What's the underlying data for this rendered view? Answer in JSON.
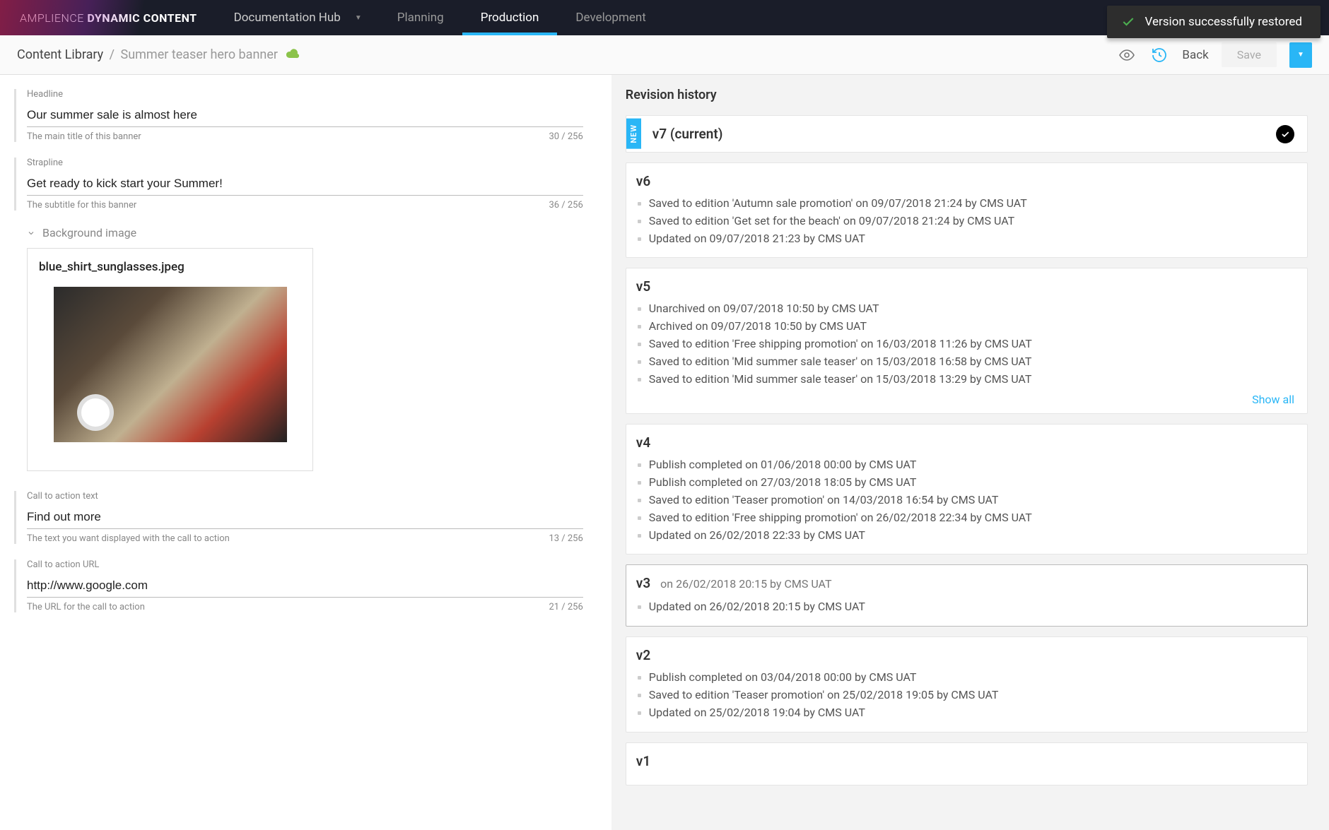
{
  "brand": {
    "light": "AMPLIENCE",
    "bold": "DYNAMIC CONTENT"
  },
  "topnav": {
    "hub": "Documentation Hub",
    "tabs": [
      {
        "label": "Planning",
        "active": false
      },
      {
        "label": "Production",
        "active": true
      },
      {
        "label": "Development",
        "active": false
      }
    ]
  },
  "toast": {
    "message": "Version successfully restored"
  },
  "breadcrumb": {
    "root": "Content Library",
    "leaf": "Summer teaser hero banner"
  },
  "subbar": {
    "back": "Back",
    "save": "Save"
  },
  "form": {
    "headline": {
      "label": "Headline",
      "value": "Our summer sale is almost here",
      "hint": "The main title of this banner",
      "counter": "30 / 256"
    },
    "strapline": {
      "label": "Strapline",
      "value": "Get ready to kick start your Summer!",
      "hint": "The subtitle for this banner",
      "counter": "36 / 256"
    },
    "background": {
      "section_label": "Background image",
      "filename": "blue_shirt_sunglasses.jpeg"
    },
    "cta_text": {
      "label": "Call to action text",
      "value": "Find out more",
      "hint": "The text you want displayed with the call to action",
      "counter": "13 / 256"
    },
    "cta_url": {
      "label": "Call to action URL",
      "value": "http://www.google.com",
      "hint": "The URL for the call to action",
      "counter": "21 / 256"
    }
  },
  "revisions": {
    "title": "Revision history",
    "show_all": "Show all",
    "current": {
      "badge": "NEW",
      "label": "v7 (current)"
    },
    "list": [
      {
        "v": "v6",
        "events": [
          "Saved to edition 'Autumn sale promotion' on 09/07/2018 21:24 by CMS UAT",
          "Saved to edition 'Get set for the beach' on 09/07/2018 21:24 by CMS UAT",
          "Updated on 09/07/2018 21:23 by CMS UAT"
        ]
      },
      {
        "v": "v5",
        "show_all": true,
        "events": [
          "Unarchived on 09/07/2018 10:50 by CMS UAT",
          "Archived on 09/07/2018 10:50 by CMS UAT",
          "Saved to edition 'Free shipping promotion' on 16/03/2018 11:26 by CMS UAT",
          "Saved to edition 'Mid summer sale teaser' on 15/03/2018 16:58 by CMS UAT",
          "Saved to edition 'Mid summer sale teaser' on 15/03/2018 13:29 by CMS UAT"
        ]
      },
      {
        "v": "v4",
        "events": [
          "Publish completed on 01/06/2018 00:00 by CMS UAT",
          "Publish completed on 27/03/2018 18:05 by CMS UAT",
          "Saved to edition 'Teaser promotion' on 14/03/2018 16:54 by CMS UAT",
          "Saved to edition 'Free shipping promotion' on 26/02/2018 22:34 by CMS UAT",
          "Updated on 26/02/2018 22:33 by CMS UAT"
        ]
      },
      {
        "v": "v3",
        "highlighted": true,
        "meta": "on 26/02/2018 20:15 by CMS UAT",
        "events": [
          "Updated on 26/02/2018 20:15 by CMS UAT"
        ]
      },
      {
        "v": "v2",
        "events": [
          "Publish completed on 03/04/2018 00:00 by CMS UAT",
          "Saved to edition 'Teaser promotion' on 25/02/2018 19:05 by CMS UAT",
          "Updated on 25/02/2018 19:04 by CMS UAT"
        ]
      },
      {
        "v": "v1",
        "events": []
      }
    ]
  }
}
